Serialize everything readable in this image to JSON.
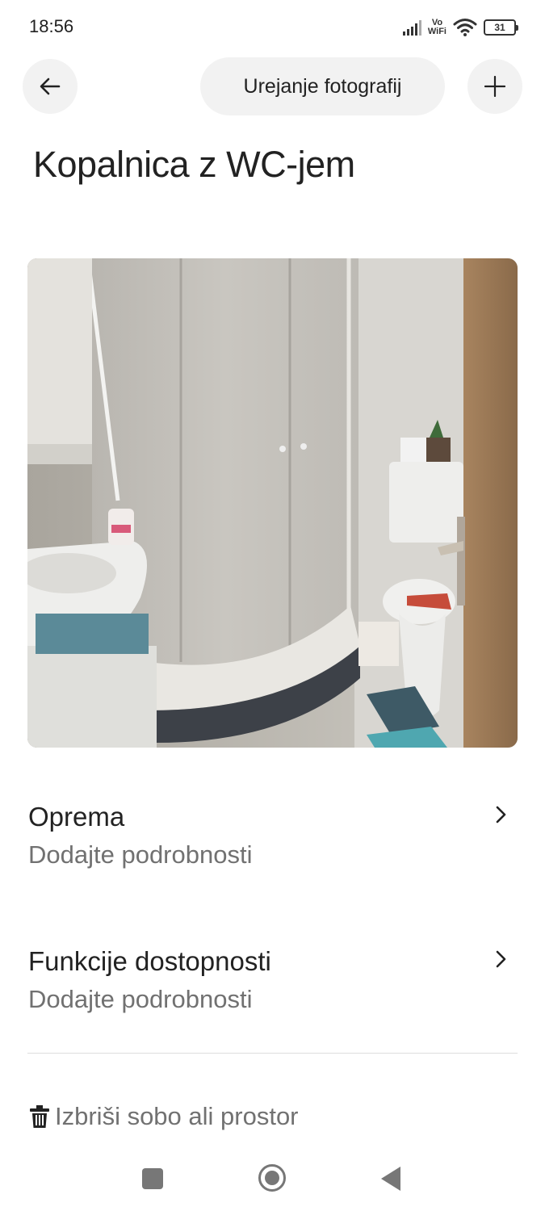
{
  "status_bar": {
    "time": "18:56",
    "network_label_top": "Vo",
    "network_label_bottom": "WiFi",
    "battery_level": "31",
    "icons": [
      "signal-icon",
      "vowifi-icon",
      "wifi-icon",
      "battery-icon"
    ]
  },
  "header": {
    "back_icon": "arrow-left-icon",
    "edit_photos_label": "Urejanje fotografij",
    "add_icon": "plus-icon"
  },
  "page": {
    "title": "Kopalnica z WC-jem"
  },
  "photo": {
    "subject": "bathroom-photo"
  },
  "sections": [
    {
      "title": "Oprema",
      "subtitle": "Dodajte podrobnosti",
      "icon": "chevron-right-icon"
    },
    {
      "title": "Funkcije dostopnosti",
      "subtitle": "Dodajte podrobnosti",
      "icon": "chevron-right-icon"
    }
  ],
  "delete": {
    "icon": "trash-icon",
    "label": "Izbriši sobo ali prostor"
  },
  "nav_bar": {
    "icons": [
      "recents-square-icon",
      "home-circle-icon",
      "back-triangle-icon"
    ]
  },
  "colors": {
    "text_primary": "#222222",
    "text_secondary": "#717171",
    "button_background": "#f2f2f2",
    "divider": "#dddddd"
  }
}
